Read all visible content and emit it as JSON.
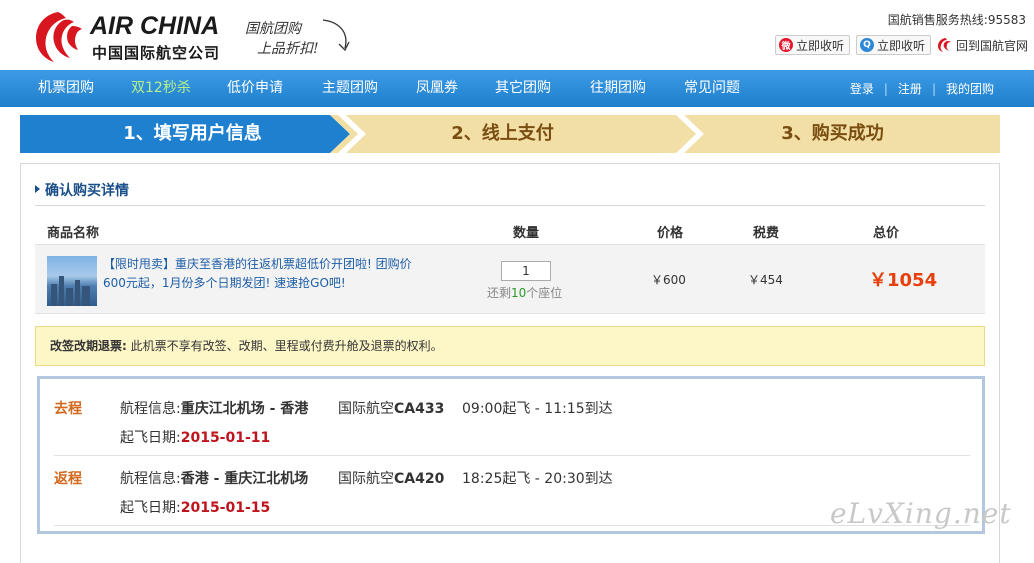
{
  "header": {
    "logo_en": "AIR CHINA",
    "logo_cn": "中国国际航空公司",
    "slogan_line1": "国航团购",
    "slogan_line2": "上品折扣!",
    "hotline": "国航销售服务热线:95583",
    "weibo_btn": "立即收听",
    "qq_btn": "立即收听",
    "home_link": "回到国航官网"
  },
  "nav": {
    "items": [
      "机票团购",
      "双12秒杀",
      "低价申请",
      "主题团购",
      "凤凰券",
      "其它团购",
      "往期团购",
      "常见问题"
    ],
    "login": "登录",
    "register": "注册",
    "my_groupbuy": "我的团购"
  },
  "steps": [
    "1、填写用户信息",
    "2、线上支付",
    "3、购买成功"
  ],
  "order": {
    "section_title": "确认购买详情",
    "columns": {
      "name": "商品名称",
      "qty": "数量",
      "price": "价格",
      "tax": "税费",
      "total": "总价"
    },
    "item": {
      "desc_line1": "【限时甩卖】重庆至香港的往返机票超低价开团啦! 团购价",
      "desc_line2": "600元起，1月份多个日期发团! 速速抢GO吧!",
      "qty": "1",
      "remain_pre": "还剩",
      "remain_num": "10",
      "remain_post": "个座位",
      "price": "￥600",
      "tax": "￥454",
      "total": "￥1054"
    },
    "notice_label": "改签改期退票:",
    "notice_text": " 此机票不享有改签、改期、里程或付费升舱及退票的权利。"
  },
  "flights": [
    {
      "tag": "去程",
      "route_label": "航程信息:",
      "route": "重庆江北机场 - 香港",
      "airline": "国际航空",
      "flight_no": "CA433",
      "time": "09:00起飞 - 11:15到达",
      "date_label": "起飞日期:",
      "date": "2015-01-11"
    },
    {
      "tag": "返程",
      "route_label": "航程信息:",
      "route": "香港 - 重庆江北机场",
      "airline": "国际航空",
      "flight_no": "CA420",
      "time": "18:25起飞 - 20:30到达",
      "date_label": "起飞日期:",
      "date": "2015-01-15"
    }
  ],
  "watermark": "eLvXing.net",
  "colors": {
    "nav_bg": "#2a8ad8",
    "step_active": "#1f7fcc",
    "step_inactive": "#f0dca0",
    "total_price": "#e8400c",
    "flight_tag": "#d2691e",
    "flight_date": "#c0141c"
  }
}
